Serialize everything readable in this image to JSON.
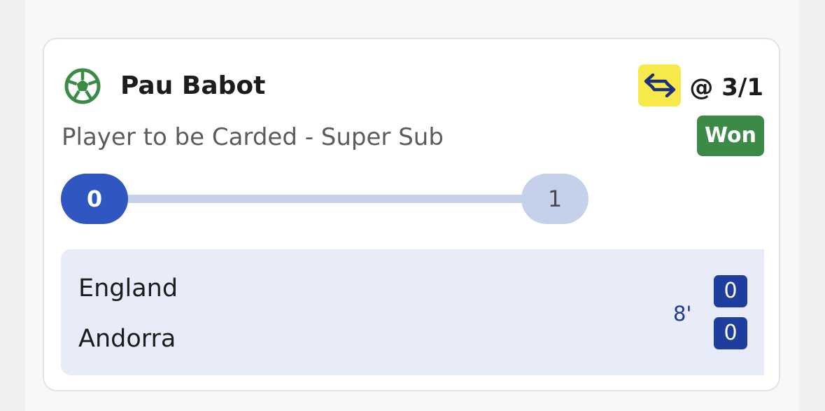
{
  "bet": {
    "player_name": "Pau Babot",
    "market": "Player to be Carded - Super Sub",
    "odds": "@ 3/1",
    "status": "Won",
    "sport_icon": "football-icon",
    "feature_icon": "super-sub-swap-icon"
  },
  "progress": {
    "current": "0",
    "target": "1",
    "fraction": 0
  },
  "match": {
    "home_team": "England",
    "away_team": "Andorra",
    "minute": "8'",
    "home_score": "0",
    "away_score": "0"
  },
  "colors": {
    "won": "#3b8a45",
    "progress_active": "#2f56c1",
    "progress_track": "#c5d0ea",
    "super_sub_badge": "#f8e94a",
    "score_box": "#1f3d9c",
    "football_icon": "#3b8a45"
  }
}
